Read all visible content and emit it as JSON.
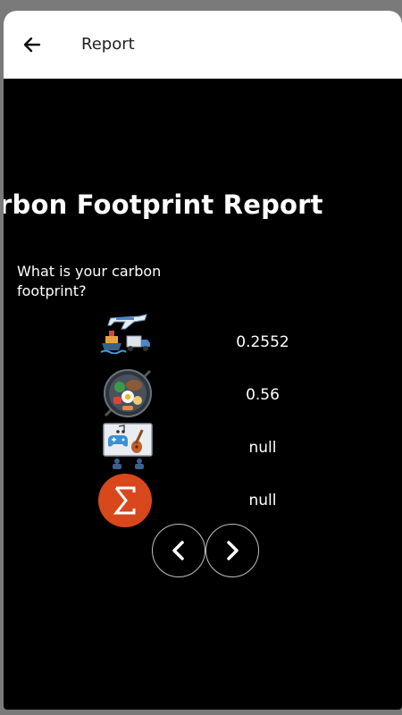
{
  "appbar": {
    "title": "Report",
    "back_icon": "arrow-left-icon"
  },
  "report": {
    "title": "rbon Footprint Report",
    "question": "What is your carbon footprint?",
    "rows": [
      {
        "icon": "transport-icon",
        "value": "0.2552"
      },
      {
        "icon": "food-icon",
        "value": "0.56"
      },
      {
        "icon": "entertainment-icon",
        "value": "null"
      },
      {
        "icon": "sum-icon",
        "value": "null"
      }
    ]
  },
  "nav": {
    "prev_icon": "chevron-left-icon",
    "next_icon": "chevron-right-icon"
  },
  "colors": {
    "background": "#000000",
    "appbar": "#ffffff",
    "sum_badge": "#d9471c"
  }
}
